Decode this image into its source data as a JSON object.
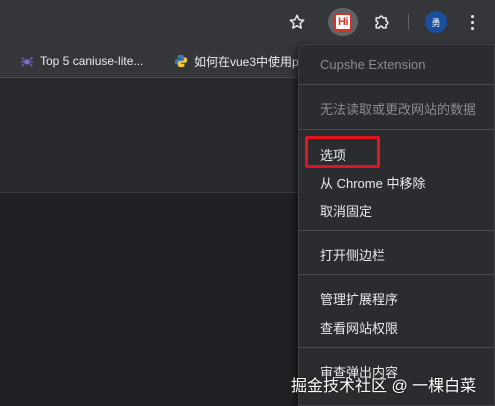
{
  "toolbar": {
    "star_icon": "star-icon",
    "active_extension": {
      "label": "Hi",
      "icon": "hi-extension-icon"
    },
    "extensions_icon": "puzzle-icon",
    "avatar_label": "勇",
    "menu_icon": "kebab-menu-icon"
  },
  "bookmarks": [
    {
      "label": "Top 5 caniuse-lite...",
      "icon": "spider-icon"
    },
    {
      "label": "如何在vue3中使用p",
      "icon": "python-icon"
    }
  ],
  "context_menu": {
    "header": "Cupshe Extension",
    "permission_note": "无法读取或更改网站的数据",
    "items_group1": [
      "选项",
      "从 Chrome 中移除",
      "取消固定"
    ],
    "items_group2": [
      "打开侧边栏"
    ],
    "items_group3": [
      "管理扩展程序",
      "查看网站权限"
    ],
    "items_group4": [
      "审查弹出内容"
    ]
  },
  "watermark": "掘金技术社区 @ 一棵白菜",
  "colors": {
    "background": "#202124",
    "toolbar": "#35363a",
    "menu": "#2b2c2f",
    "highlight": "#e3141f"
  }
}
